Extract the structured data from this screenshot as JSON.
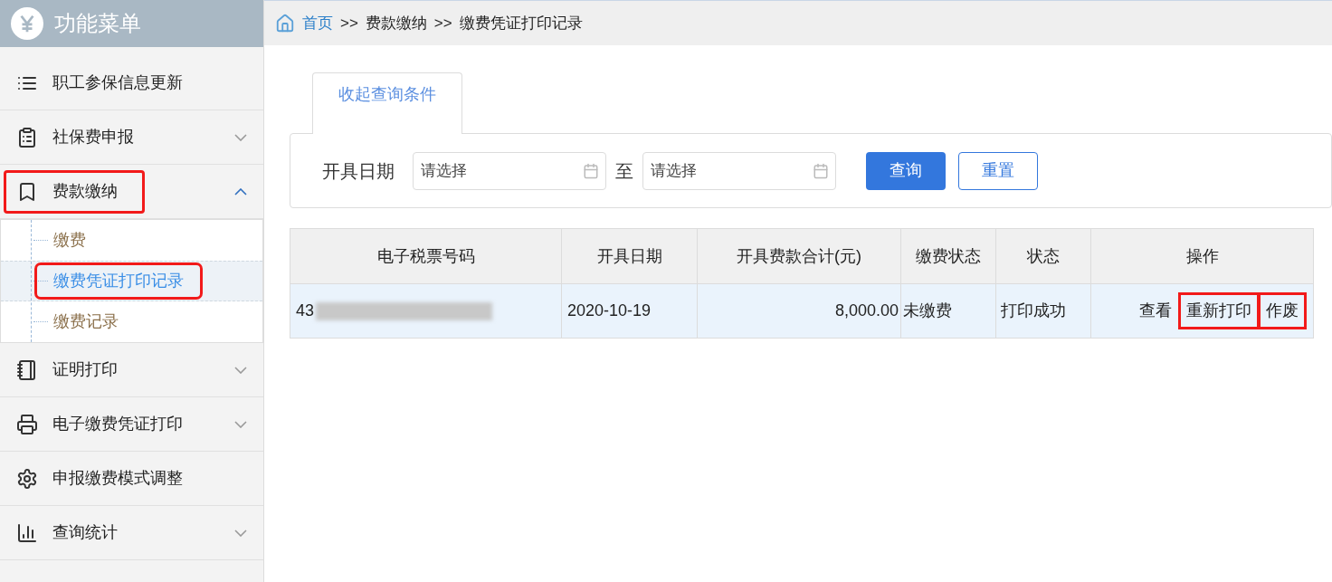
{
  "sidebar": {
    "title": "功能菜单",
    "items": [
      {
        "label": "职工参保信息更新",
        "expandable": false,
        "highlighted": false
      },
      {
        "label": "社保费申报",
        "expandable": true,
        "expanded": false,
        "highlighted": false
      },
      {
        "label": "费款缴纳",
        "expandable": true,
        "expanded": true,
        "highlighted": true,
        "children": [
          {
            "label": "缴费",
            "selected": false,
            "highlighted": false
          },
          {
            "label": "缴费凭证打印记录",
            "selected": true,
            "highlighted": true
          },
          {
            "label": "缴费记录",
            "selected": false,
            "highlighted": false
          }
        ]
      },
      {
        "label": "证明打印",
        "expandable": true,
        "expanded": false,
        "highlighted": false
      },
      {
        "label": "电子缴费凭证打印",
        "expandable": true,
        "expanded": false,
        "highlighted": false
      },
      {
        "label": "申报缴费模式调整",
        "expandable": false,
        "highlighted": false
      },
      {
        "label": "查询统计",
        "expandable": true,
        "expanded": false,
        "highlighted": false
      }
    ]
  },
  "breadcrumb": [
    {
      "label": "首页",
      "link": true
    },
    {
      "label": ">>",
      "link": false
    },
    {
      "label": "费款缴纳",
      "link": false
    },
    {
      "label": ">>",
      "link": false
    },
    {
      "label": "缴费凭证打印记录",
      "link": false
    }
  ],
  "query_tab": "收起查询条件",
  "filter": {
    "label": "开具日期",
    "from_placeholder": "请选择",
    "separator": "至",
    "to_placeholder": "请选择",
    "buttons": [
      {
        "label": "查询",
        "kind": "primary"
      },
      {
        "label": "重置",
        "kind": "outline"
      }
    ]
  },
  "table": {
    "columns": [
      "电子税票号码",
      "开具日期",
      "开具费款合计(元)",
      "缴费状态",
      "状态",
      "操作"
    ],
    "rows": [
      {
        "ticket_no": "43",
        "date": "2020-10-19",
        "total": "8,000.00",
        "payment_status": "未缴费",
        "status": "打印成功",
        "selected": true,
        "actions": [
          {
            "label": "查看",
            "highlighted": false
          },
          {
            "label": "重新打印",
            "highlighted": true
          },
          {
            "label": "作废",
            "highlighted": true
          }
        ]
      }
    ]
  }
}
